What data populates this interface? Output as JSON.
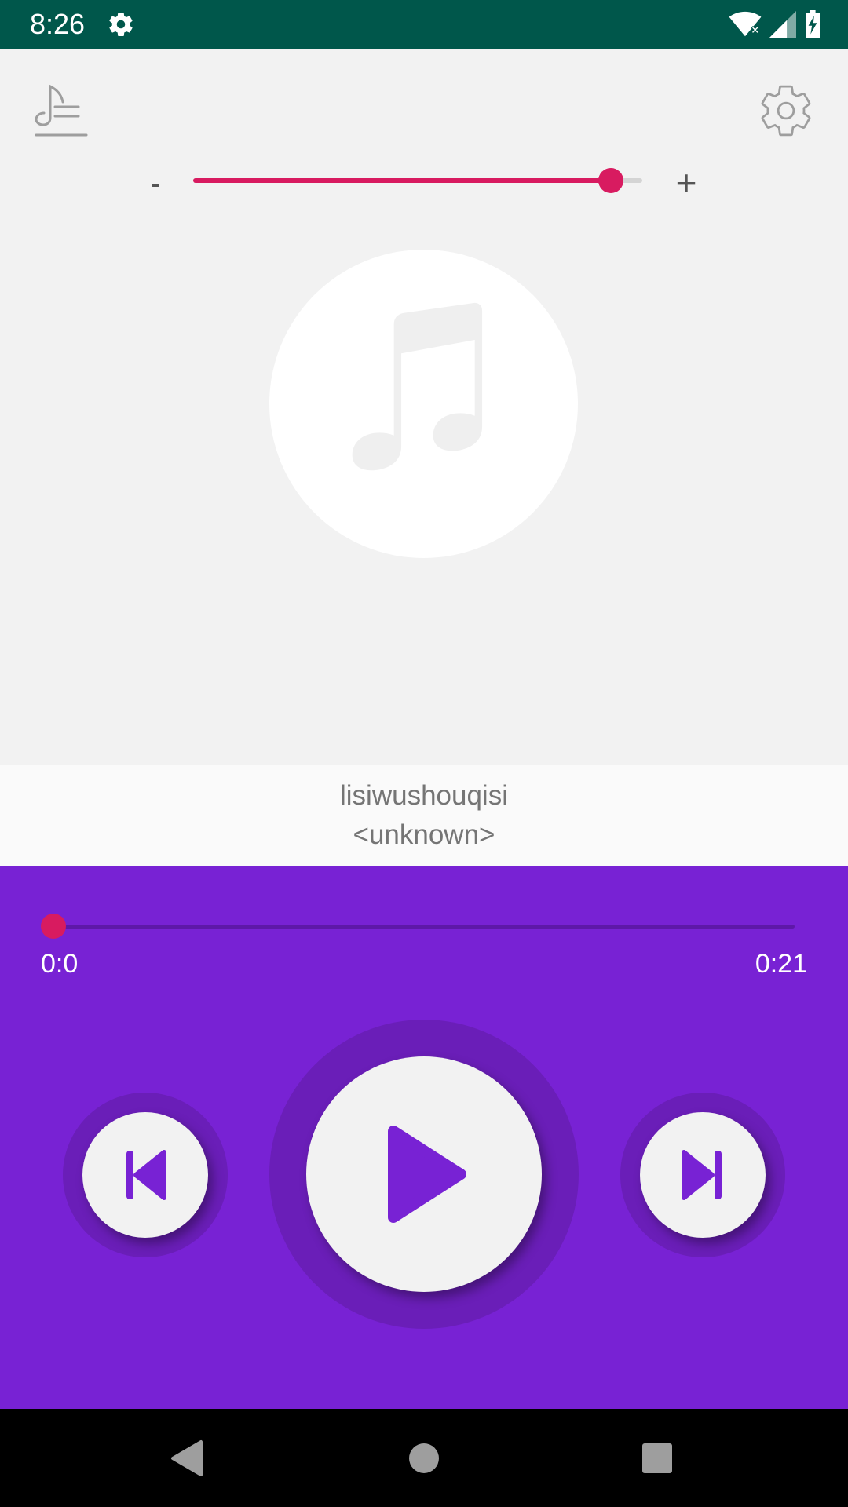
{
  "status_bar": {
    "time": "8:26",
    "icons": [
      "settings-icon",
      "wifi-icon",
      "signal-icon",
      "battery-charging-icon"
    ]
  },
  "toolbar": {
    "left_icon": "playlist-icon",
    "right_icon": "settings-icon"
  },
  "volume": {
    "minus_label": "-",
    "plus_label": "+",
    "level": 0.93,
    "accent": "#d81b60"
  },
  "album": {
    "art_icon": "music-note-icon"
  },
  "track": {
    "title": "lisiwushouqisi",
    "artist": "<unknown>"
  },
  "progress": {
    "current": "0:0",
    "total": "0:21",
    "fraction": 0.0
  },
  "controls": {
    "previous_icon": "skip-previous-icon",
    "play_icon": "play-icon",
    "next_icon": "skip-next-icon",
    "accent": "#7822d4"
  },
  "nav_bar": {
    "icons": [
      "back-icon",
      "home-icon",
      "recents-icon"
    ]
  }
}
